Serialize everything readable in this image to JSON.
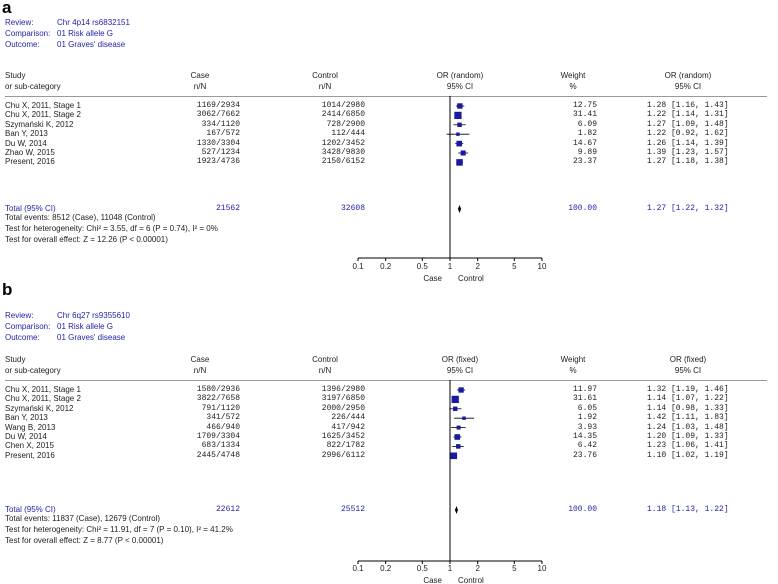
{
  "panels": [
    {
      "letter": "a",
      "review_label": "Review:",
      "review": "Chr 4p14 rs6832151",
      "comparison_label": "Comparison:",
      "comparison": "01 Risk allele G",
      "outcome_label": "Outcome:",
      "outcome": "01 Graves' disease",
      "col_study": "Study",
      "col_study2": "or sub-category",
      "col_case": "Case",
      "col_case2": "n/N",
      "col_control": "Control",
      "col_control2": "n/N",
      "col_or": "OR (random)",
      "col_or2": "95% CI",
      "col_weight": "Weight",
      "col_weight2": "%",
      "col_orci": "OR (random)",
      "col_orci2": "95% CI",
      "rows": [
        {
          "study": "Chu X, 2011, Stage 1",
          "case": "1169/2934",
          "control": "1014/2980",
          "weight": "12.75",
          "or_text": "1.28 [1.16, 1.43]"
        },
        {
          "study": "Chu X, 2011, Stage 2",
          "case": "3062/7662",
          "control": "2414/6850",
          "weight": "31.41",
          "or_text": "1.22 [1.14, 1.31]"
        },
        {
          "study": "Szymański K, 2012",
          "case": "334/1120",
          "control": "728/2900",
          "weight": "6.09",
          "or_text": "1.27 [1.09, 1.48]"
        },
        {
          "study": "Ban Y, 2013",
          "case": "167/572",
          "control": "112/444",
          "weight": "1.82",
          "or_text": "1.22 [0.92, 1.62]"
        },
        {
          "study": "Du W, 2014",
          "case": "1330/3304",
          "control": "1202/3452",
          "weight": "14.67",
          "or_text": "1.26 [1.14, 1.39]"
        },
        {
          "study": "Zhao W, 2015",
          "case": "527/1234",
          "control": "3428/9830",
          "weight": "9.89",
          "or_text": "1.39 [1.23, 1.57]"
        },
        {
          "study": "Present, 2016",
          "case": "1923/4736",
          "control": "2150/6152",
          "weight": "23.37",
          "or_text": "1.27 [1.18, 1.38]"
        }
      ],
      "total": {
        "study": "Total (95% CI)",
        "case": "21562",
        "control": "32608",
        "weight": "100.00",
        "or_text": "1.27 [1.22, 1.32]"
      },
      "footnotes": [
        "Total events: 8512 (Case), 11048 (Control)",
        "Test for heterogeneity: Chi² = 3.55, df = 6 (P = 0.74), I² = 0%",
        "Test for overall effect: Z = 12.26 (P < 0.00001)"
      ],
      "axis_left": "Case",
      "axis_right": "Control"
    },
    {
      "letter": "b",
      "review_label": "Review:",
      "review": "Chr 6q27 rs9355610",
      "comparison_label": "Comparison:",
      "comparison": "01 Risk allele G",
      "outcome_label": "Outcome:",
      "outcome": "01 Graves' disease",
      "col_study": "Study",
      "col_study2": "or sub-category",
      "col_case": "Case",
      "col_case2": "n/N",
      "col_control": "Control",
      "col_control2": "n/N",
      "col_or": "OR (fixed)",
      "col_or2": "95% CI",
      "col_weight": "Weight",
      "col_weight2": "%",
      "col_orci": "OR (fixed)",
      "col_orci2": "95% CI",
      "rows": [
        {
          "study": "Chu X, 2011, Stage 1",
          "case": "1580/2936",
          "control": "1396/2980",
          "weight": "11.97",
          "or_text": "1.32 [1.19, 1.46]"
        },
        {
          "study": "Chu X, 2011, Stage 2",
          "case": "3822/7658",
          "control": "3197/6850",
          "weight": "31.61",
          "or_text": "1.14 [1.07, 1.22]"
        },
        {
          "study": "Szymański K, 2012",
          "case": "791/1120",
          "control": "2000/2950",
          "weight": "6.05",
          "or_text": "1.14 [0.98, 1.33]"
        },
        {
          "study": "Ban Y, 2013",
          "case": "341/572",
          "control": "226/444",
          "weight": "1.92",
          "or_text": "1.42 [1.11, 1.83]"
        },
        {
          "study": "Wang B, 2013",
          "case": "466/940",
          "control": "417/942",
          "weight": "3.93",
          "or_text": "1.24 [1.03, 1.48]"
        },
        {
          "study": "Du W, 2014",
          "case": "1709/3304",
          "control": "1625/3452",
          "weight": "14.35",
          "or_text": "1.20 [1.09, 1.33]"
        },
        {
          "study": "Chen X, 2015",
          "case": "683/1334",
          "control": "822/1782",
          "weight": "6.42",
          "or_text": "1.23 [1.06, 1.41]"
        },
        {
          "study": "Present, 2016",
          "case": "2445/4748",
          "control": "2996/6112",
          "weight": "23.76",
          "or_text": "1.10 [1.02, 1.19]"
        }
      ],
      "total": {
        "study": "Total (95% CI)",
        "case": "22612",
        "control": "25512",
        "weight": "100.00",
        "or_text": "1.18 [1.13, 1.22]"
      },
      "footnotes": [
        "Total events: 11837 (Case), 12679 (Control)",
        "Test for heterogeneity: Chi² = 11.91, df = 7 (P = 0.10), I² = 41.2%",
        "Test for overall effect: Z = 8.77 (P < 0.00001)"
      ],
      "axis_left": "Case",
      "axis_right": "Control"
    }
  ],
  "colors": {
    "text": "#222222",
    "meta": "#1f1fa8",
    "marker": "#1a1aa0",
    "line": "#000000",
    "rule": "#9a9a9a"
  },
  "chart_data": [
    {
      "type": "forest",
      "scale": "log",
      "xlim": [
        0.1,
        10
      ],
      "xticks": [
        "0.1",
        "0.2",
        "0.5",
        "1",
        "2",
        "5",
        "10"
      ],
      "xtick_values": [
        0.1,
        0.2,
        0.5,
        1,
        2,
        5,
        10
      ],
      "series": [
        {
          "or": 1.28,
          "lo": 1.16,
          "hi": 1.43,
          "weight": 12.75
        },
        {
          "or": 1.22,
          "lo": 1.14,
          "hi": 1.31,
          "weight": 31.41
        },
        {
          "or": 1.27,
          "lo": 1.09,
          "hi": 1.48,
          "weight": 6.09
        },
        {
          "or": 1.22,
          "lo": 0.92,
          "hi": 1.62,
          "weight": 1.82
        },
        {
          "or": 1.26,
          "lo": 1.14,
          "hi": 1.39,
          "weight": 14.67
        },
        {
          "or": 1.39,
          "lo": 1.23,
          "hi": 1.57,
          "weight": 9.89
        },
        {
          "or": 1.27,
          "lo": 1.18,
          "hi": 1.38,
          "weight": 23.37
        }
      ],
      "pooled": {
        "or": 1.27,
        "lo": 1.22,
        "hi": 1.32
      }
    },
    {
      "type": "forest",
      "scale": "log",
      "xlim": [
        0.1,
        10
      ],
      "xticks": [
        "0.1",
        "0.2",
        "0.5",
        "1",
        "2",
        "5",
        "10"
      ],
      "xtick_values": [
        0.1,
        0.2,
        0.5,
        1,
        2,
        5,
        10
      ],
      "series": [
        {
          "or": 1.32,
          "lo": 1.19,
          "hi": 1.46,
          "weight": 11.97
        },
        {
          "or": 1.14,
          "lo": 1.07,
          "hi": 1.22,
          "weight": 31.61
        },
        {
          "or": 1.14,
          "lo": 0.98,
          "hi": 1.33,
          "weight": 6.05
        },
        {
          "or": 1.42,
          "lo": 1.11,
          "hi": 1.83,
          "weight": 1.92
        },
        {
          "or": 1.24,
          "lo": 1.03,
          "hi": 1.48,
          "weight": 3.93
        },
        {
          "or": 1.2,
          "lo": 1.09,
          "hi": 1.33,
          "weight": 14.35
        },
        {
          "or": 1.23,
          "lo": 1.06,
          "hi": 1.41,
          "weight": 6.42
        },
        {
          "or": 1.1,
          "lo": 1.02,
          "hi": 1.19,
          "weight": 23.76
        }
      ],
      "pooled": {
        "or": 1.18,
        "lo": 1.13,
        "hi": 1.22
      }
    }
  ]
}
